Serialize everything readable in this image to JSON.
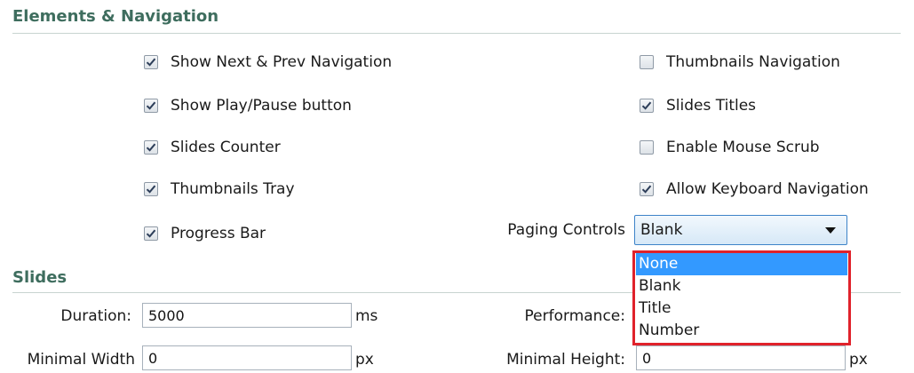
{
  "sections": {
    "elements_title": "Elements & Navigation",
    "slides_title": "Slides"
  },
  "elements": {
    "show_next_prev": {
      "label": "Show Next & Prev Navigation",
      "checked": true
    },
    "show_play_pause": {
      "label": "Show Play/Pause button",
      "checked": true
    },
    "slides_counter": {
      "label": "Slides Counter",
      "checked": true
    },
    "thumbnails_tray": {
      "label": "Thumbnails Tray",
      "checked": true
    },
    "progress_bar": {
      "label": "Progress Bar",
      "checked": true
    },
    "thumbnails_navigation": {
      "label": "Thumbnails Navigation",
      "checked": false
    },
    "slides_titles": {
      "label": "Slides Titles",
      "checked": true
    },
    "enable_mouse_scrub": {
      "label": "Enable Mouse Scrub",
      "checked": false
    },
    "allow_keyboard_navigation": {
      "label": "Allow Keyboard Navigation",
      "checked": true
    }
  },
  "paging": {
    "label": "Paging Controls",
    "selected": "Blank",
    "options": [
      "None",
      "Blank",
      "Title",
      "Number"
    ],
    "highlighted": "None"
  },
  "slides": {
    "duration_label": "Duration:",
    "duration_value": "5000",
    "duration_unit": "ms",
    "performance_label": "Performance:",
    "min_width_label": "Minimal Width",
    "min_width_value": "0",
    "min_width_unit": "px",
    "min_height_label": "Minimal Height:",
    "min_height_value": "0",
    "min_height_unit": "px"
  }
}
